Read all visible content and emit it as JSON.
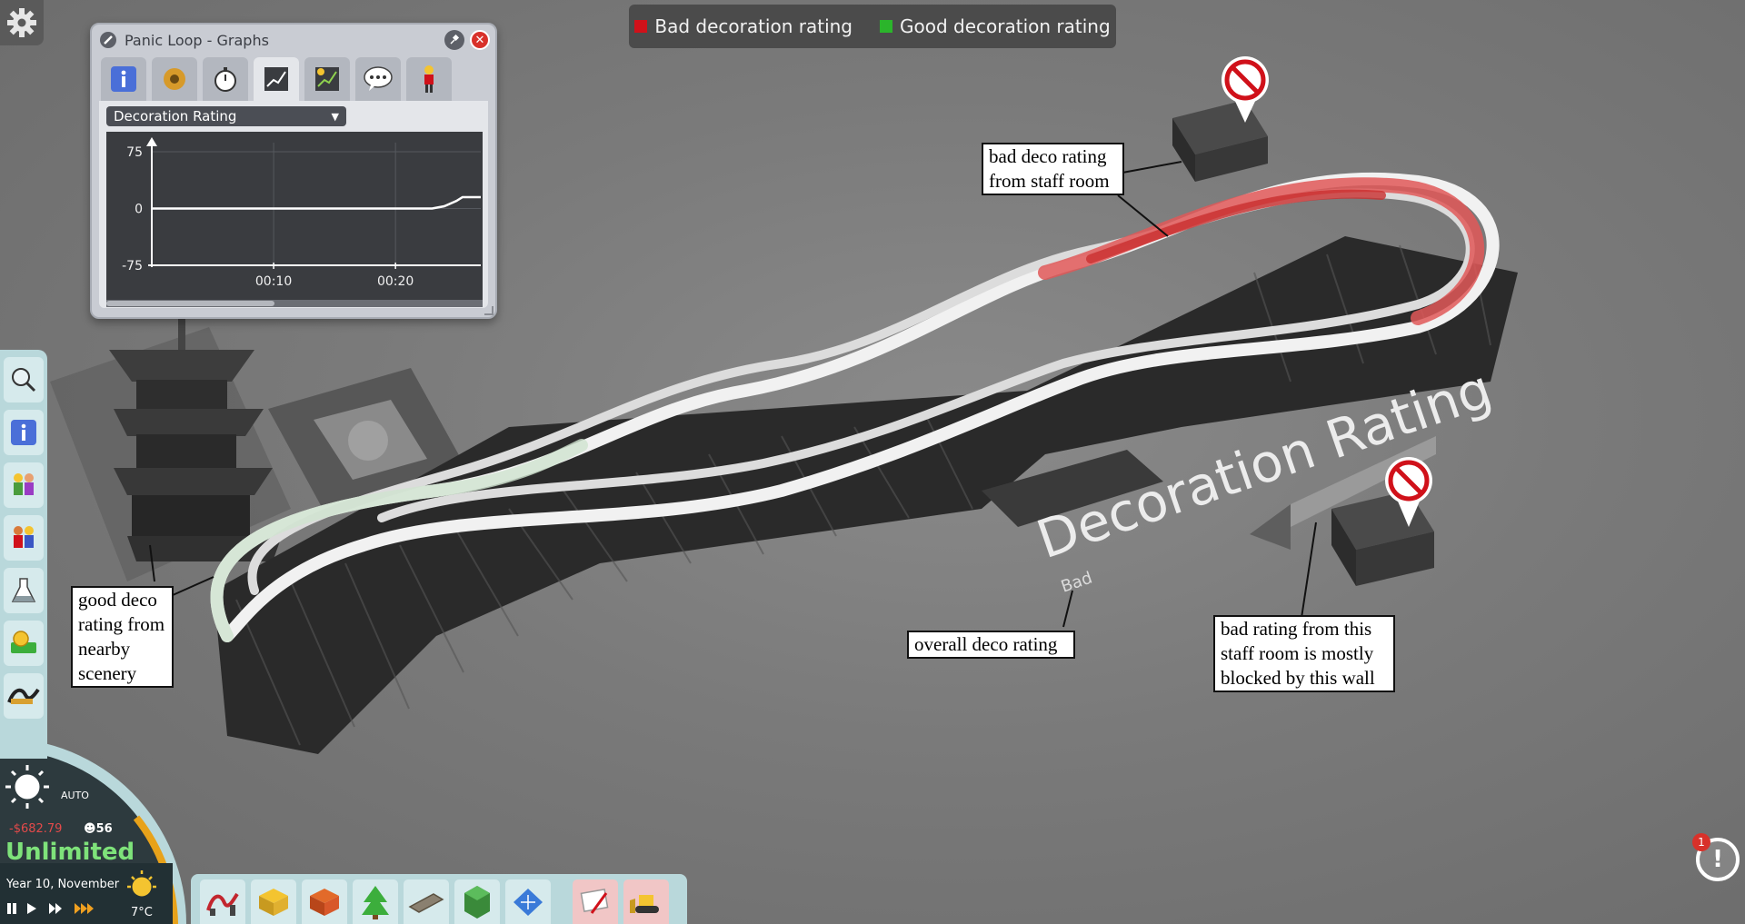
{
  "legend": {
    "bad_label": "Bad decoration rating",
    "bad_color": "#d0111a",
    "good_label": "Good decoration rating",
    "good_color": "#2bb52b"
  },
  "graph_window": {
    "title": "Panic Loop - Graphs",
    "tabs": [
      "info-icon",
      "gear-icon",
      "stopwatch-icon",
      "line-graph-icon",
      "rating-graph-icon",
      "speech-icon",
      "guest-icon"
    ],
    "active_tab_index": 3,
    "selected_graph": "Decoration Rating",
    "chart_data": {
      "type": "line",
      "title": "",
      "xlabel": "",
      "ylabel": "",
      "yticks": [
        "75",
        "0",
        "-75"
      ],
      "xticks": [
        "00:10",
        "00:20"
      ],
      "ylim": [
        -75,
        75
      ],
      "x": [
        0,
        5,
        10,
        15,
        20,
        21,
        22,
        23,
        24,
        25,
        25.5,
        26,
        27
      ],
      "values": [
        0,
        0,
        0,
        0,
        0,
        0,
        0,
        0,
        3,
        10,
        15,
        15,
        15
      ]
    }
  },
  "scene": {
    "floating_text": "Decoration Rating",
    "floating_sub": "Bad"
  },
  "annotations": {
    "staff_room": "bad deco rating\nfrom staff room",
    "scenery": "good deco\nrating from\nnearby\nscenery",
    "overall": "overall deco rating",
    "wall": "bad rating from this\nstaff room is mostly\nblocked by this wall"
  },
  "left_toolbar": [
    "magnifier-icon",
    "info-icon",
    "guests-icon",
    "staff-icon",
    "research-icon",
    "finance-icon",
    "rides-icon"
  ],
  "status": {
    "weather_mode": "AUTO",
    "money": "-$682.79",
    "guests": "56",
    "budget": "Unlimited",
    "date": "Year 10, November",
    "temperature": "7°C"
  },
  "build_toolbar": [
    "ride-icon",
    "shop-icon",
    "facility-icon",
    "tree-icon",
    "path-icon",
    "terrain-icon",
    "blueprint-icon",
    "paint-icon",
    "bulldozer-icon"
  ],
  "notification": {
    "count": "1"
  }
}
